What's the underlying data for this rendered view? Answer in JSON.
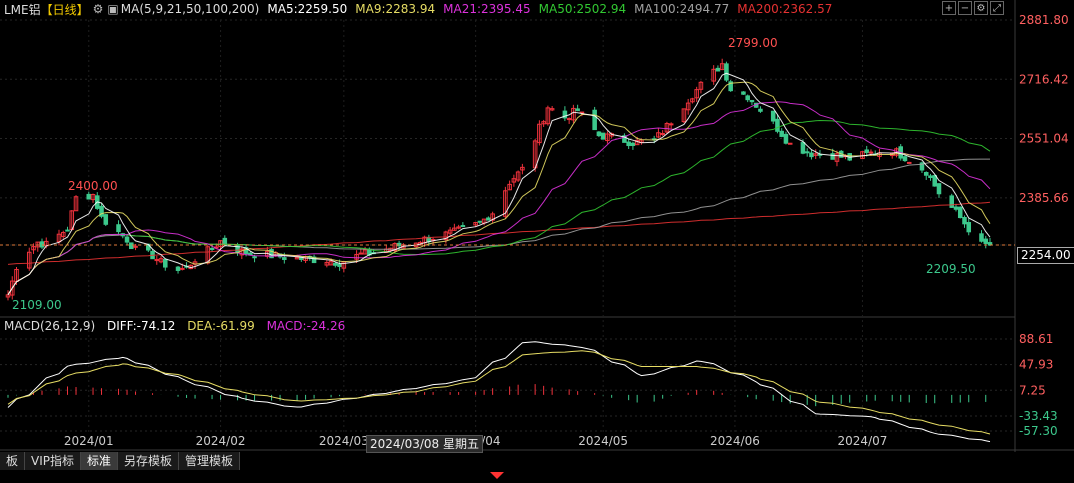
{
  "legend": {
    "symbol": "LME铝",
    "period": "【日线】",
    "ma_label": "MA(5,9,21,50,100,200)",
    "ma5": "MA5:2259.50",
    "ma9": "MA9:2283.94",
    "ma21": "MA21:2395.45",
    "ma50": "MA50:2502.94",
    "ma100": "MA100:2494.77",
    "ma200": "MA200:2362.57"
  },
  "macd_legend": {
    "label": "MACD(26,12,9)",
    "diff": "DIFF:-74.12",
    "dea": "DEA:-61.99",
    "macd": "MACD:-24.26"
  },
  "colors": {
    "up": "#f0323c",
    "down": "#3cc88c",
    "ma5": "#ffffff",
    "ma9": "#e6dc64",
    "ma21": "#dc32dc",
    "ma50": "#32c832",
    "ma100": "#a0a0a0",
    "ma200": "#e63232"
  },
  "current_price": "2254.00",
  "tooltip": "2024/03/08 星期五",
  "tabs": [
    "板",
    "VIP指标",
    "标准",
    "另存模板",
    "管理模板"
  ],
  "toolbar_icons": [
    "plus-square-icon",
    "minus-square-icon",
    "settings-icon",
    "expand-icon"
  ],
  "chart_data": [
    {
      "type": "candlestick",
      "title": "LME铝【日线】",
      "ylim": [
        2109,
        2881.8
      ],
      "y_ticks": [
        "2881.80",
        "2716.42",
        "2551.04",
        "2385.66",
        "2254.00"
      ],
      "x_ticks": [
        "2024/01",
        "2024/02",
        "2024/03",
        "2024/04",
        "2024/05",
        "2024/06",
        "2024/07"
      ],
      "annotations": {
        "high_2400": "2400.00",
        "low_2109": "2109.00",
        "high_2799": "2799.00",
        "low_2209": "2209.50"
      },
      "close_path": [
        [
          "2023-12-13",
          2109
        ],
        [
          "2023-12-15",
          2195
        ],
        [
          "2023-12-18",
          2240
        ],
        [
          "2023-12-20",
          2262
        ],
        [
          "2023-12-22",
          2255
        ],
        [
          "2023-12-27",
          2300
        ],
        [
          "2023-12-29",
          2385
        ],
        [
          "2024-01-02",
          2395
        ],
        [
          "2024-01-04",
          2330
        ],
        [
          "2024-01-08",
          2290
        ],
        [
          "2024-01-10",
          2270
        ],
        [
          "2024-01-12",
          2240
        ],
        [
          "2024-01-16",
          2225
        ],
        [
          "2024-01-18",
          2205
        ],
        [
          "2024-01-22",
          2185
        ],
        [
          "2024-01-24",
          2190
        ],
        [
          "2024-01-26",
          2215
        ],
        [
          "2024-01-30",
          2245
        ],
        [
          "2024-02-01",
          2265
        ],
        [
          "2024-02-05",
          2240
        ],
        [
          "2024-02-08",
          2230
        ],
        [
          "2024-02-13",
          2225
        ],
        [
          "2024-02-16",
          2220
        ],
        [
          "2024-02-21",
          2215
        ],
        [
          "2024-02-26",
          2212
        ],
        [
          "2024-02-29",
          2205
        ],
        [
          "2024-03-05",
          2228
        ],
        [
          "2024-03-08",
          2232
        ],
        [
          "2024-03-13",
          2250
        ],
        [
          "2024-03-18",
          2265
        ],
        [
          "2024-03-22",
          2275
        ],
        [
          "2024-03-27",
          2290
        ],
        [
          "2024-04-02",
          2315
        ],
        [
          "2024-04-05",
          2345
        ],
        [
          "2024-04-09",
          2430
        ],
        [
          "2024-04-12",
          2465
        ],
        [
          "2024-04-15",
          2550
        ],
        [
          "2024-04-18",
          2640
        ],
        [
          "2024-04-22",
          2610
        ],
        [
          "2024-04-25",
          2630
        ],
        [
          "2024-04-30",
          2560
        ],
        [
          "2024-05-03",
          2555
        ],
        [
          "2024-05-08",
          2540
        ],
        [
          "2024-05-13",
          2545
        ],
        [
          "2024-05-16",
          2585
        ],
        [
          "2024-05-21",
          2660
        ],
        [
          "2024-05-24",
          2700
        ],
        [
          "2024-05-29",
          2760
        ],
        [
          "2024-05-31",
          2690
        ],
        [
          "2024-06-04",
          2670
        ],
        [
          "2024-06-06",
          2645
        ],
        [
          "2024-06-11",
          2580
        ],
        [
          "2024-06-14",
          2535
        ],
        [
          "2024-06-19",
          2510
        ],
        [
          "2024-06-24",
          2505
        ],
        [
          "2024-06-28",
          2495
        ],
        [
          "2024-07-03",
          2510
        ],
        [
          "2024-07-08",
          2520
        ],
        [
          "2024-07-11",
          2500
        ],
        [
          "2024-07-16",
          2460
        ],
        [
          "2024-07-19",
          2400
        ],
        [
          "2024-07-24",
          2330
        ],
        [
          "2024-07-29",
          2255
        ],
        [
          "2024-07-31",
          2254
        ]
      ]
    },
    {
      "type": "line",
      "title": "MACD(26,12,9)",
      "ylim": [
        -57.3,
        88.61
      ],
      "y_ticks": [
        "88.61",
        "47.93",
        "7.25",
        "-33.43",
        "-57.30"
      ],
      "series": [
        {
          "name": "DIFF",
          "values": [
            -20,
            45,
            60,
            25,
            -5,
            -20,
            -5,
            10,
            25,
            85,
            75,
            30,
            55,
            20,
            -30,
            -35,
            -60,
            -74.12
          ]
        },
        {
          "name": "DEA",
          "values": [
            -15,
            30,
            50,
            30,
            5,
            -10,
            -5,
            5,
            20,
            65,
            70,
            45,
            45,
            28,
            -10,
            -25,
            -45,
            -61.99
          ]
        }
      ]
    }
  ]
}
